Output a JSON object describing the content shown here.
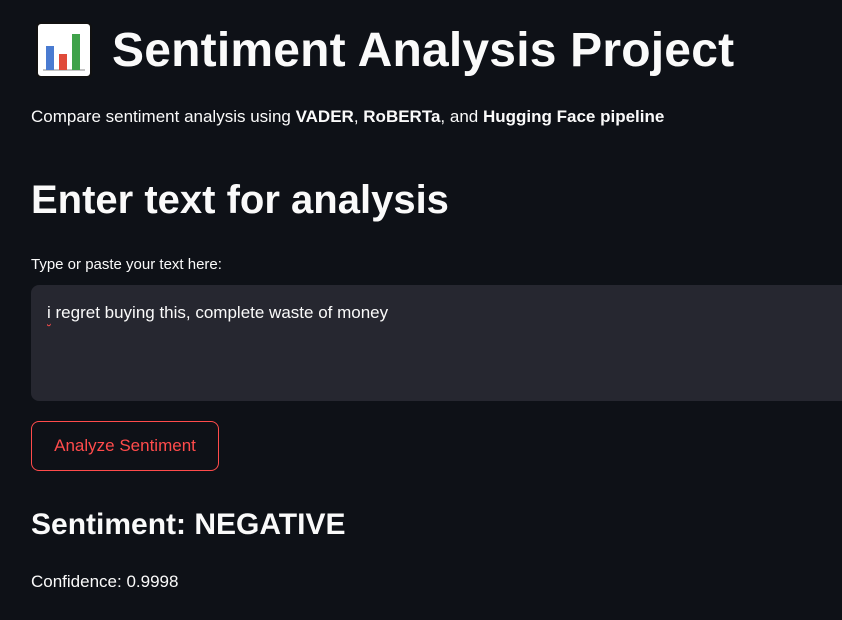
{
  "header": {
    "icon": "bar-chart-icon",
    "title": "Sentiment Analysis Project"
  },
  "subtitle": {
    "prefix": "Compare sentiment analysis using ",
    "vader": "VADER",
    "comma": ", ",
    "roberta": "RoBERTa",
    "and": ", and ",
    "hf": "Hugging Face pipeline"
  },
  "input_section": {
    "heading": "Enter text for analysis",
    "label": "Type or paste your text here:",
    "value_first": "i",
    "value_rest": " regret buying this, complete waste of money"
  },
  "actions": {
    "analyze_label": "Analyze Sentiment",
    "accent_color": "#ff4b4b"
  },
  "result": {
    "sentiment_heading": "Sentiment: NEGATIVE",
    "confidence_text": "Confidence: 0.9998"
  }
}
